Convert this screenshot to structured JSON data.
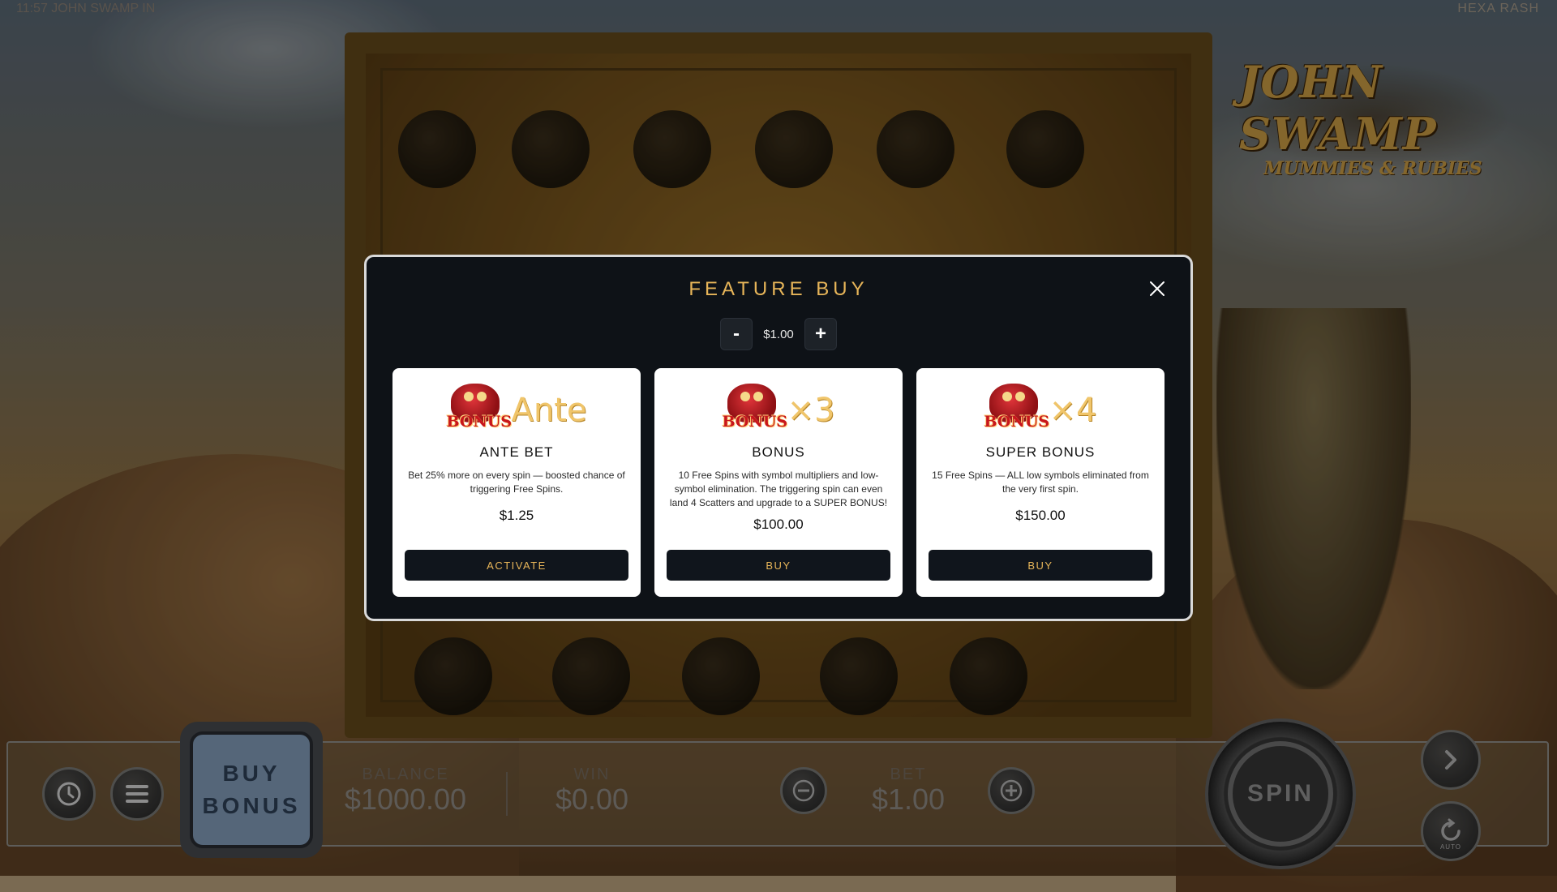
{
  "status_bar": {
    "left_text": "11:57 JOHN SWAMP IN",
    "right_text": "HEXA RASH"
  },
  "logo": {
    "line1": "JOHN SWAMP",
    "line2": "MUMMIES & RUBIES"
  },
  "modal": {
    "title": "FEATURE BUY",
    "close_icon": "close-icon",
    "bet_stepper": {
      "minus_label": "-",
      "value": "$1.00",
      "plus_label": "+"
    },
    "cards": [
      {
        "badge": "BONUS",
        "tag": "Ante",
        "title": "ANTE BET",
        "description": "Bet 25% more on every spin — boosted chance of triggering Free Spins.",
        "price": "$1.25",
        "button_label": "ACTIVATE"
      },
      {
        "badge": "BONUS",
        "tag": "×3",
        "title": "BONUS",
        "description": "10 Free Spins with symbol multipliers and low-symbol elimination. The triggering spin can even land 4 Scatters and upgrade to a SUPER BONUS!",
        "price": "$100.00",
        "button_label": "BUY"
      },
      {
        "badge": "BONUS",
        "tag": "×4",
        "title": "SUPER BONUS",
        "description": "15 Free Spins — ALL low symbols eliminated from the very first spin.",
        "price": "$150.00",
        "button_label": "BUY"
      }
    ]
  },
  "bottom_bar": {
    "buy_bonus_line1": "BUY",
    "buy_bonus_line2": "BONUS",
    "balance_label": "BALANCE",
    "balance_value": "$1000.00",
    "win_label": "WIN",
    "win_value": "$0.00",
    "bet_label": "BET",
    "bet_value": "$1.00",
    "spin_label": "SPIN",
    "auto_label": "AUTO"
  },
  "colors": {
    "accent_gold": "#e7b559",
    "modal_bg": "#0e1217",
    "button_bg": "#10151c"
  }
}
